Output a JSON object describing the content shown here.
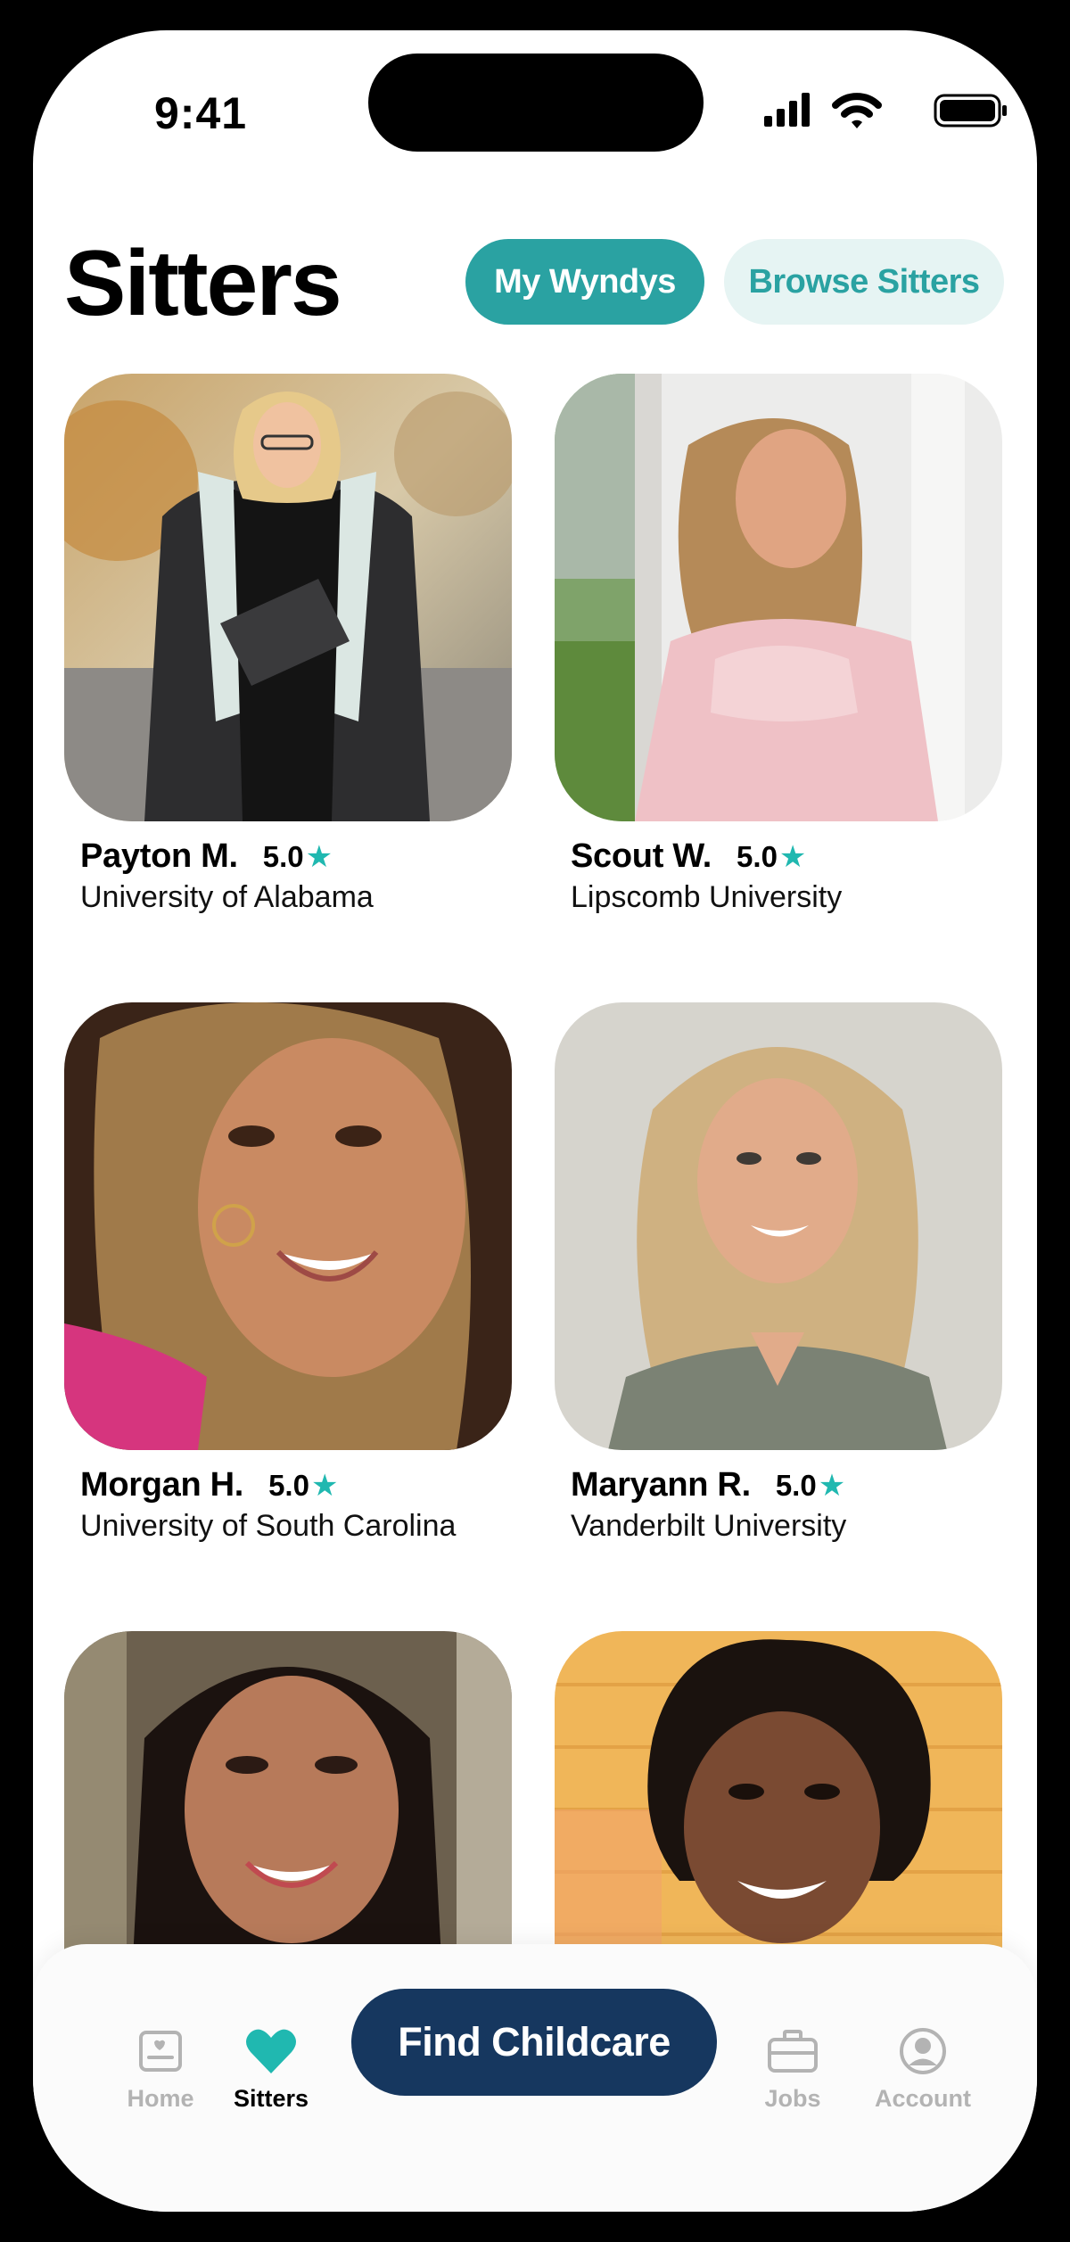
{
  "status_bar": {
    "time": "9:41"
  },
  "header": {
    "title": "Sitters",
    "tabs": [
      {
        "label": "My Wyndys",
        "active": true
      },
      {
        "label": "Browse Sitters",
        "active": false
      }
    ]
  },
  "sitters": [
    {
      "name": "Payton M.",
      "rating": "5.0",
      "school": "University of Alabama"
    },
    {
      "name": "Scout W.",
      "rating": "5.0",
      "school": "Lipscomb University"
    },
    {
      "name": "Morgan H.",
      "rating": "5.0",
      "school": "University of South Carolina"
    },
    {
      "name": "Maryann R.",
      "rating": "5.0",
      "school": "Vanderbilt University"
    }
  ],
  "bottom_nav": {
    "items": [
      {
        "label": "Home",
        "icon": "home-card-icon",
        "active": false
      },
      {
        "label": "Sitters",
        "icon": "heart-icon",
        "active": true
      },
      {
        "label": "Jobs",
        "icon": "briefcase-icon",
        "active": false
      },
      {
        "label": "Account",
        "icon": "account-icon",
        "active": false
      }
    ],
    "cta_label": "Find Childcare"
  },
  "colors": {
    "accent": "#2aa2a2",
    "accent_light": "#e6f4f3",
    "star": "#20b8b0",
    "cta": "#16375f"
  },
  "icons": {
    "star": "★"
  }
}
